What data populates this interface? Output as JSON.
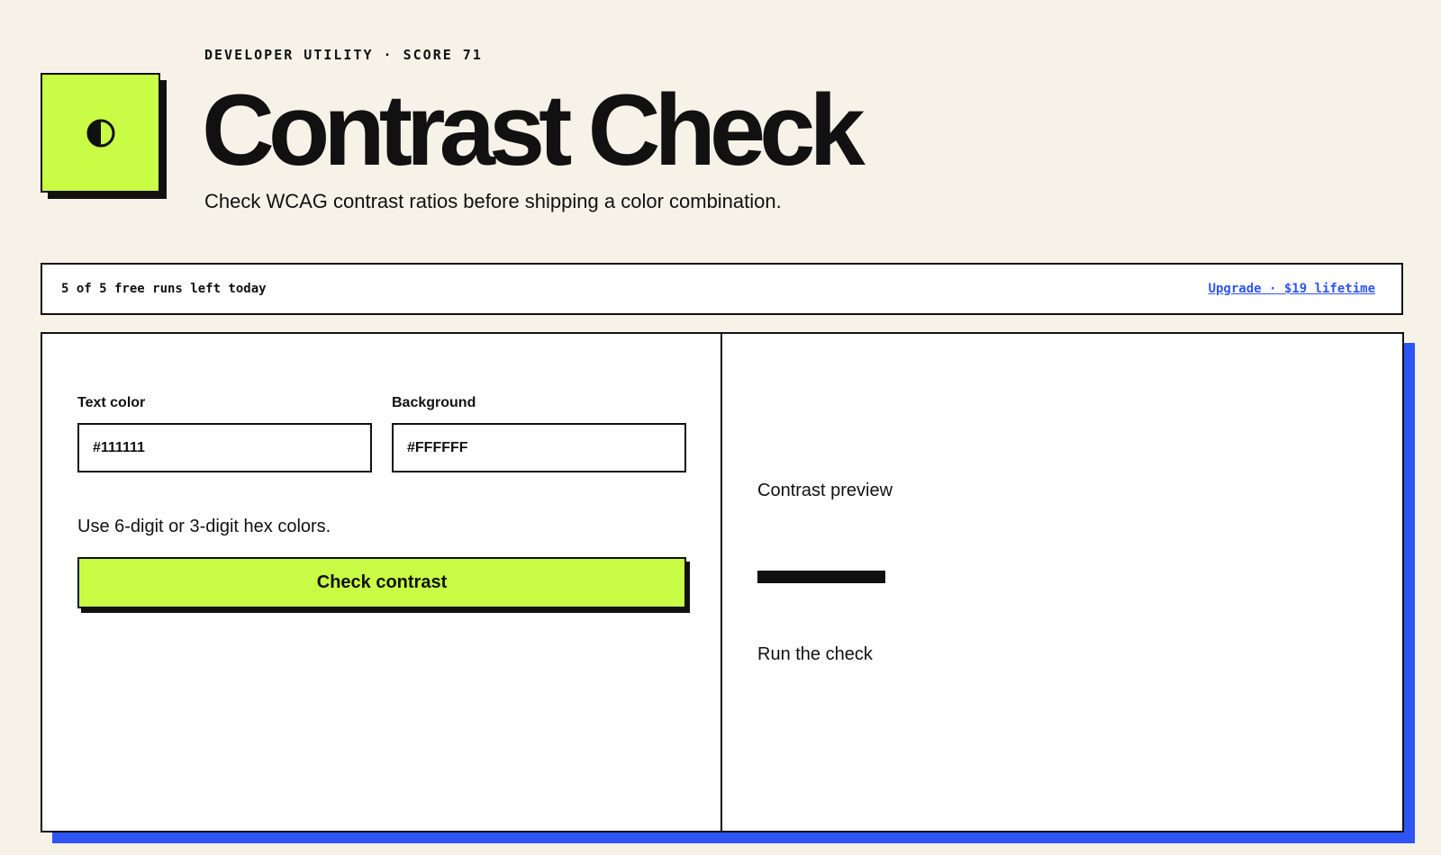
{
  "header": {
    "eyebrow": "DEVELOPER UTILITY · SCORE 71",
    "title": "Contrast Check",
    "subtitle": "Check WCAG contrast ratios before shipping a color combination.",
    "logo_icon": "half-contrast-icon"
  },
  "usage": {
    "runs_left": "5 of 5 free runs left today",
    "upgrade_label": "Upgrade · $19 lifetime"
  },
  "form": {
    "text_color_label": "Text color",
    "text_color_value": "#111111",
    "background_label": "Background",
    "background_value": "#FFFFFF",
    "hint": "Use 6-digit or 3-digit hex colors.",
    "submit_label": "Check contrast"
  },
  "preview": {
    "label": "Contrast preview",
    "result_text": "Run the check"
  },
  "colors": {
    "page_background": "#f6f2e8",
    "accent": "#c9fd45",
    "link": "#2f55f5",
    "panel_shadow": "#2f55f5",
    "ink": "#111111"
  }
}
